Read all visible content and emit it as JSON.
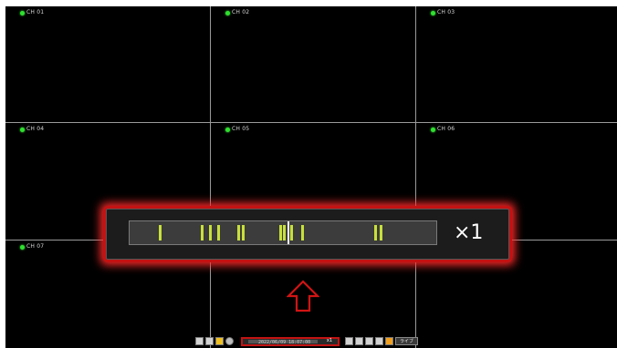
{
  "channels": [
    {
      "label": "CH 01"
    },
    {
      "label": "CH 02"
    },
    {
      "label": "CH 03"
    },
    {
      "label": "CH 04"
    },
    {
      "label": "CH 05"
    },
    {
      "label": "CH 06"
    },
    {
      "label": "CH 07"
    }
  ],
  "zoom_timeline": {
    "speed": "×1"
  },
  "toolbar": {
    "zoom_icon": "magnifier-icon",
    "mini_speed": "x1",
    "live_label": "ライブ",
    "datetime": "2022/06/09 18:07:00"
  },
  "colors": {
    "status_green": "#2ee12e",
    "marker_yellow_green": "#c8e03a",
    "highlight_red": "#c41212"
  }
}
